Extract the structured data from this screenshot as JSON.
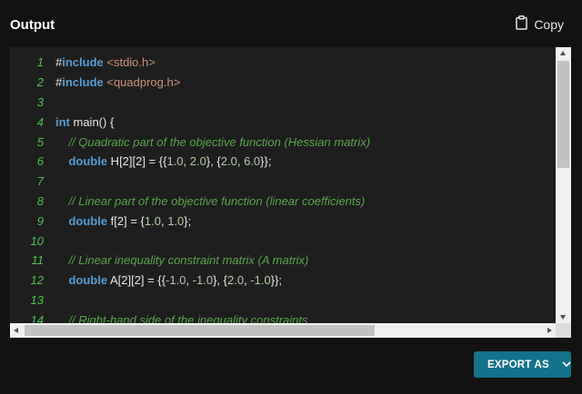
{
  "header": {
    "title": "Output",
    "copy_label": "Copy"
  },
  "code": {
    "lines": [
      {
        "n": "1",
        "parts": [
          {
            "t": "#",
            "c": "plain"
          },
          {
            "t": "include",
            "c": "kw"
          },
          {
            "t": " <stdio.h>",
            "c": "inc"
          }
        ]
      },
      {
        "n": "2",
        "parts": [
          {
            "t": "#",
            "c": "plain"
          },
          {
            "t": "include",
            "c": "kw"
          },
          {
            "t": " <quadprog.h>",
            "c": "inc"
          }
        ]
      },
      {
        "n": "3",
        "parts": []
      },
      {
        "n": "4",
        "parts": [
          {
            "t": "int",
            "c": "kw"
          },
          {
            "t": " main() {",
            "c": "plain"
          }
        ]
      },
      {
        "n": "5",
        "parts": [
          {
            "t": "    // Quadratic part of the objective function (Hessian matrix)",
            "c": "cm"
          }
        ]
      },
      {
        "n": "6",
        "parts": [
          {
            "t": "    ",
            "c": "plain"
          },
          {
            "t": "double",
            "c": "kw"
          },
          {
            "t": " H[2][2] = {{",
            "c": "plain"
          },
          {
            "t": "1.0",
            "c": "num"
          },
          {
            "t": ", ",
            "c": "plain"
          },
          {
            "t": "2.0",
            "c": "num"
          },
          {
            "t": "}, {",
            "c": "plain"
          },
          {
            "t": "2.0",
            "c": "num"
          },
          {
            "t": ", ",
            "c": "plain"
          },
          {
            "t": "6.0",
            "c": "num"
          },
          {
            "t": "}};",
            "c": "plain"
          }
        ]
      },
      {
        "n": "7",
        "parts": []
      },
      {
        "n": "8",
        "parts": [
          {
            "t": "    // Linear part of the objective function (linear coefficients)",
            "c": "cm"
          }
        ]
      },
      {
        "n": "9",
        "parts": [
          {
            "t": "    ",
            "c": "plain"
          },
          {
            "t": "double",
            "c": "kw"
          },
          {
            "t": " f[2] = {",
            "c": "plain"
          },
          {
            "t": "1.0",
            "c": "num"
          },
          {
            "t": ", ",
            "c": "plain"
          },
          {
            "t": "1.0",
            "c": "num"
          },
          {
            "t": "};",
            "c": "plain"
          }
        ]
      },
      {
        "n": "10",
        "parts": []
      },
      {
        "n": "11",
        "parts": [
          {
            "t": "    // Linear inequality constraint matrix (A matrix)",
            "c": "cm"
          }
        ]
      },
      {
        "n": "12",
        "parts": [
          {
            "t": "    ",
            "c": "plain"
          },
          {
            "t": "double",
            "c": "kw"
          },
          {
            "t": " A[2][2] = {{",
            "c": "plain"
          },
          {
            "t": "-1.0",
            "c": "num"
          },
          {
            "t": ", ",
            "c": "plain"
          },
          {
            "t": "-1.0",
            "c": "num"
          },
          {
            "t": "}, {",
            "c": "plain"
          },
          {
            "t": "2.0",
            "c": "num"
          },
          {
            "t": ", ",
            "c": "plain"
          },
          {
            "t": "-1.0",
            "c": "num"
          },
          {
            "t": "}};",
            "c": "plain"
          }
        ]
      },
      {
        "n": "13",
        "parts": []
      },
      {
        "n": "14",
        "parts": [
          {
            "t": "    // Right-hand side of the inequality constraints",
            "c": "cm"
          }
        ]
      }
    ]
  },
  "footer": {
    "export_label": "EXPORT AS"
  },
  "icons": {
    "copy": "clipboard-icon",
    "export": "chevron-down-icon"
  },
  "colors": {
    "background": "#121212",
    "code_background": "#1e1e1e",
    "line_number": "#4ec64e",
    "keyword": "#569cd6",
    "include_path": "#ce9178",
    "comment": "#57a64a",
    "number": "#b5cea8",
    "export_button": "#14728a"
  }
}
